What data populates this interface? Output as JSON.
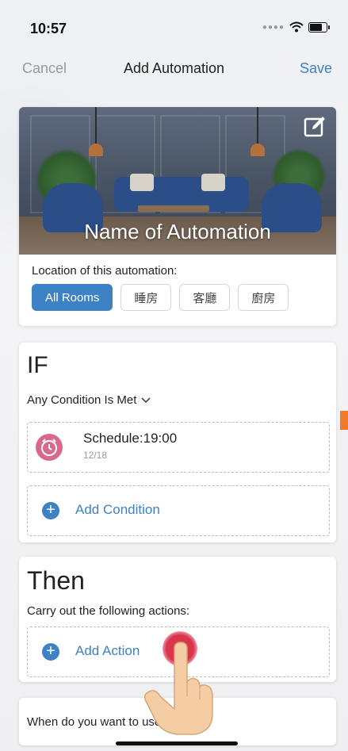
{
  "status": {
    "time": "10:57"
  },
  "nav": {
    "cancel": "Cancel",
    "title": "Add Automation",
    "save": "Save"
  },
  "hero": {
    "title": "Name of Automation"
  },
  "location": {
    "label": "Location of this automation:",
    "rooms": [
      "All Rooms",
      "睡房",
      "客廳",
      "廚房"
    ],
    "selected": "All Rooms"
  },
  "if_section": {
    "heading": "IF",
    "mode": "Any Condition Is Met",
    "conditions": [
      {
        "title": "Schedule:19:00",
        "subtitle": "12/18"
      }
    ],
    "add_label": "Add Condition"
  },
  "then_section": {
    "heading": "Then",
    "subtitle": "Carry out the following actions:",
    "add_label": "Add Action"
  },
  "footer_question": "When do you want to use this rule?",
  "colors": {
    "accent": "#3d82c4",
    "alarm": "#d9698a",
    "touch": "#d8344a"
  }
}
